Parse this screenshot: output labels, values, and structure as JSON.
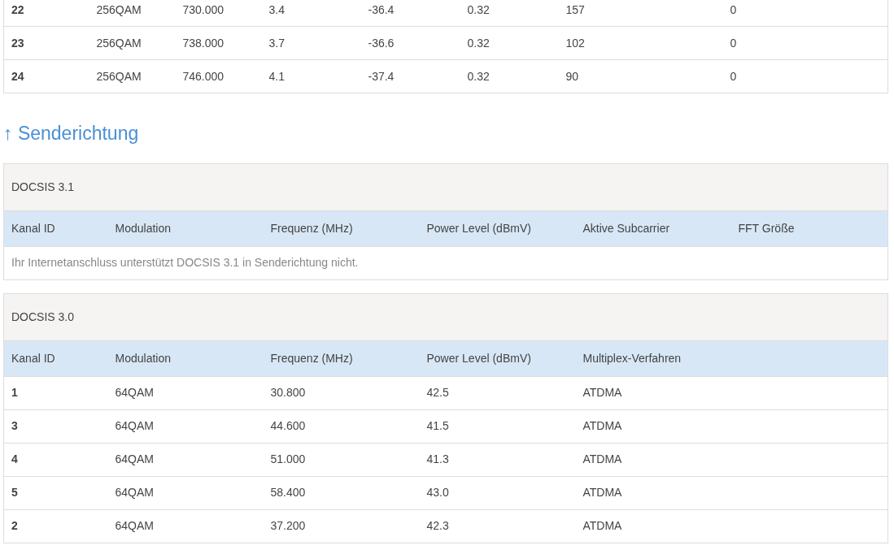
{
  "downstream_rows": [
    {
      "cells": [
        "22",
        "256QAM",
        "730.000",
        "3.4",
        "-36.4",
        "0.32",
        "157",
        "0"
      ]
    },
    {
      "cells": [
        "23",
        "256QAM",
        "738.000",
        "3.7",
        "-36.6",
        "0.32",
        "102",
        "0"
      ]
    },
    {
      "cells": [
        "24",
        "256QAM",
        "746.000",
        "4.1",
        "-37.4",
        "0.32",
        "90",
        "0"
      ]
    }
  ],
  "upstream": {
    "heading": "↑ Senderichtung",
    "panels": [
      {
        "title": "DOCSIS 3.1",
        "columns": [
          "Kanal ID",
          "Modulation",
          "Frequenz (MHz)",
          "Power Level (dBmV)",
          "Aktive Subcarrier",
          "FFT Größe"
        ],
        "message": "Ihr Internetanschluss unterstützt DOCSIS 3.1 in Senderichtung nicht."
      },
      {
        "title": "DOCSIS 3.0",
        "columns": [
          "Kanal ID",
          "Modulation",
          "Frequenz (MHz)",
          "Power Level (dBmV)",
          "Multiplex-Verfahren"
        ],
        "rows": [
          [
            "1",
            "64QAM",
            "30.800",
            "42.5",
            "ATDMA"
          ],
          [
            "3",
            "64QAM",
            "44.600",
            "41.5",
            "ATDMA"
          ],
          [
            "4",
            "64QAM",
            "51.000",
            "41.3",
            "ATDMA"
          ],
          [
            "5",
            "64QAM",
            "58.400",
            "43.0",
            "ATDMA"
          ],
          [
            "2",
            "64QAM",
            "37.200",
            "42.3",
            "ATDMA"
          ]
        ]
      }
    ]
  }
}
